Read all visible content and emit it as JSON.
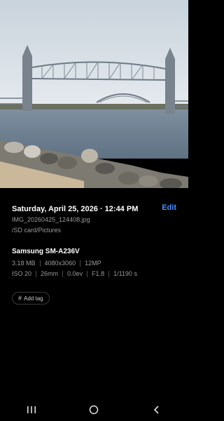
{
  "photo": {
    "description_icon": "photo-viewer-image"
  },
  "info": {
    "datetime": "Saturday, April 25, 2026 · 12:44 PM",
    "edit_label": "Edit",
    "filename": "IMG_20260425_124408.jpg",
    "path": "/SD card/Pictures",
    "device": "Samsung SM-A236V",
    "size": "3.18 MB",
    "resolution": "4080x3060",
    "megapixels": "12MP",
    "iso": "ISO 20",
    "focal_length": "26mm",
    "exposure": "0.0ev",
    "aperture": "F1.8",
    "shutter": "1/1190 s"
  },
  "tag": {
    "icon": "hash-icon",
    "label": "Add tag"
  },
  "navigation": {
    "recents_icon": "recents-icon",
    "home_icon": "home-icon",
    "back_icon": "back-icon"
  },
  "colors": {
    "accent": "#4e8cff",
    "background": "#000000",
    "secondary_text": "#9a9a9a"
  }
}
